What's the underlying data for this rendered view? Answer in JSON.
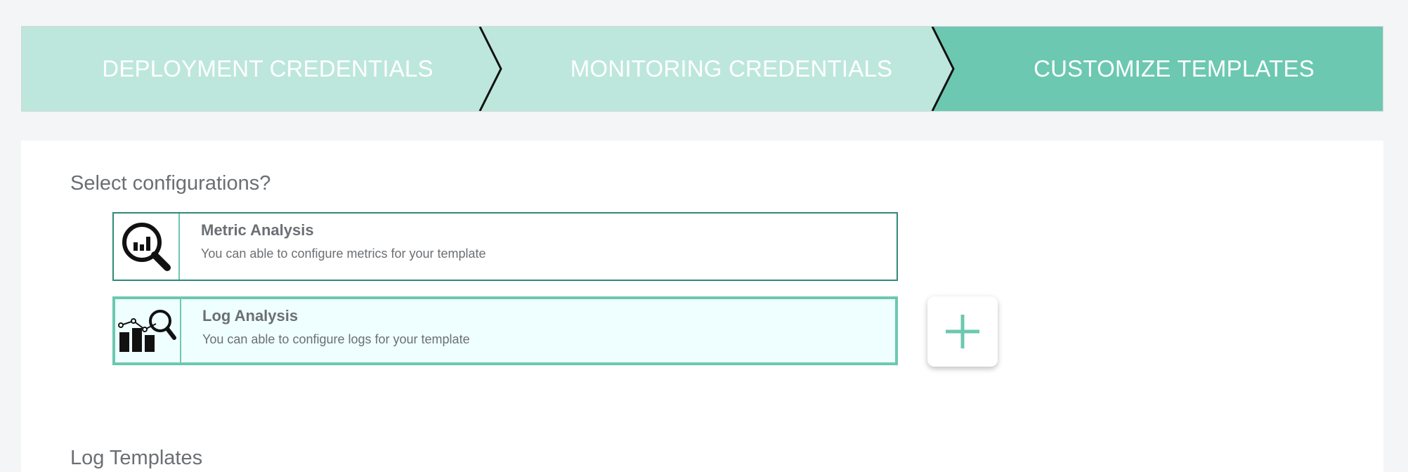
{
  "stepper": {
    "steps": [
      {
        "label": "DEPLOYMENT CREDENTIALS",
        "state": "complete"
      },
      {
        "label": "MONITORING CREDENTIALS",
        "state": "complete"
      },
      {
        "label": "CUSTOMIZE TEMPLATES",
        "state": "active"
      }
    ],
    "colors": {
      "inactive": "#bde7dc",
      "active": "#6cc8b0",
      "chevron": "#111111"
    }
  },
  "configurations": {
    "title": "Select configurations?",
    "cards": [
      {
        "icon": "magnifier-chart-icon",
        "title": "Metric Analysis",
        "description": "You can able to configure metrics for your template",
        "selected": false
      },
      {
        "icon": "chart-magnifier-icon",
        "title": "Log Analysis",
        "description": "You can able to configure logs for your template",
        "selected": true
      }
    ],
    "add_button_icon": "plus-icon"
  },
  "log_templates": {
    "title": "Log Templates"
  },
  "colors": {
    "accent": "#6cc8b0",
    "accent_dark": "#2e8a78",
    "text": "#6b6f73",
    "background": "#f4f5f7"
  }
}
